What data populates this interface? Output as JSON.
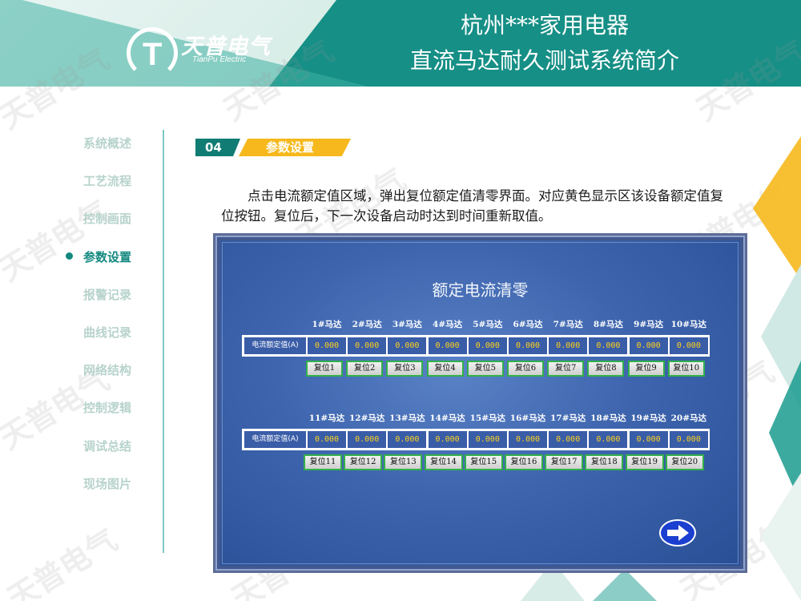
{
  "header": {
    "company_name": "天普电气",
    "company_sub": "TianPu Electric",
    "title_line1": "杭州***家用电器",
    "title_line2": "直流马达耐久测试系统简介"
  },
  "watermark": "天普电气",
  "sidebar": {
    "items": [
      {
        "label": "系统概述"
      },
      {
        "label": "工艺流程"
      },
      {
        "label": "控制画面"
      },
      {
        "label": "参数设置",
        "active": true
      },
      {
        "label": "报警记录"
      },
      {
        "label": "曲线记录"
      },
      {
        "label": "网络结构"
      },
      {
        "label": "控制逻辑"
      },
      {
        "label": "调试总结"
      },
      {
        "label": "现场图片"
      }
    ]
  },
  "section": {
    "number": "04",
    "label": "参数设置"
  },
  "description": "点击电流额定值区域，弹出复位额定值清零界面。对应黄色显示区该设备额定值复位按钮。复位后，下一次设备启动时达到时间重新取值。",
  "hmi": {
    "title": "额定电流清零",
    "row_label": "电流额定值(A)",
    "groups": [
      {
        "motors": [
          "1#马达",
          "2#马达",
          "3#马达",
          "4#马达",
          "5#马达",
          "6#马达",
          "7#马达",
          "8#马达",
          "9#马达",
          "10#马达"
        ],
        "values": [
          "0.000",
          "0.000",
          "0.000",
          "0.000",
          "0.000",
          "0.000",
          "0.000",
          "0.000",
          "0.000",
          "0.000"
        ],
        "buttons": [
          "复位1",
          "复位2",
          "复位3",
          "复位4",
          "复位5",
          "复位6",
          "复位7",
          "复位8",
          "复位9",
          "复位10"
        ]
      },
      {
        "motors": [
          "11#马达",
          "12#马达",
          "13#马达",
          "14#马达",
          "15#马达",
          "16#马达",
          "17#马达",
          "18#马达",
          "19#马达",
          "20#马达"
        ],
        "values": [
          "0.000",
          "0.000",
          "0.000",
          "0.000",
          "0.000",
          "0.000",
          "0.000",
          "0.000",
          "0.000",
          "0.000"
        ],
        "buttons": [
          "复位11",
          "复位12",
          "复位13",
          "复位14",
          "复位15",
          "复位16",
          "复位17",
          "复位18",
          "复位19",
          "复位20"
        ]
      }
    ],
    "next_icon": "arrow-right-icon"
  },
  "colors": {
    "primary": "#168f86",
    "accent": "#f6b81c",
    "value_text": "#ffd21a",
    "button_border": "#32b04a"
  }
}
